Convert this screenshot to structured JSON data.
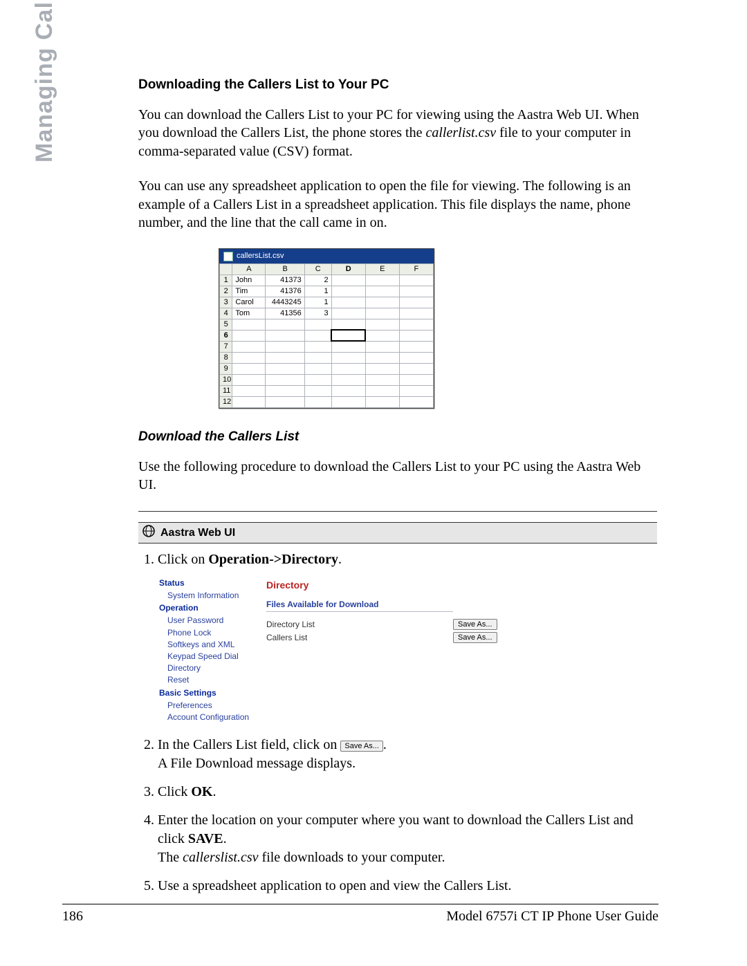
{
  "sidebar_label": "Managing Calls",
  "section": {
    "title": "Downloading the Callers List to Your PC",
    "para1_a": "You can download the Callers List to your PC for viewing using the Aastra Web UI. When you download the Callers List, the phone stores the ",
    "para1_file": "callerlist.csv",
    "para1_b": " file to your computer in comma-separated value (CSV) format.",
    "para2": "You can use any spreadsheet application to open the file for viewing. The following is an example of a Callers List in a spreadsheet application. This file displays the name, phone number, and the line that the call came in on."
  },
  "spreadsheet": {
    "filename": "callersList.csv",
    "cols": [
      "A",
      "B",
      "C",
      "D",
      "E",
      "F"
    ],
    "rows": [
      {
        "rh": "1",
        "A": "John",
        "B": "41373",
        "C": "2"
      },
      {
        "rh": "2",
        "A": "Tim",
        "B": "41376",
        "C": "1"
      },
      {
        "rh": "3",
        "A": "Carol",
        "B": "4443245",
        "C": "1"
      },
      {
        "rh": "4",
        "A": "Tom",
        "B": "41356",
        "C": "3"
      },
      {
        "rh": "5"
      },
      {
        "rh": "6"
      },
      {
        "rh": "7"
      },
      {
        "rh": "8"
      },
      {
        "rh": "9"
      },
      {
        "rh": "10"
      },
      {
        "rh": "11"
      },
      {
        "rh": "12"
      }
    ],
    "selected_row": 6,
    "selected_col": "D"
  },
  "procedure": {
    "subtitle": "Download the Callers List",
    "intro": "Use the following procedure to download the Callers List to your PC using the Aastra Web UI.",
    "bar_label": "Aastra Web UI",
    "step1_a": "Click on ",
    "step1_b": "Operation->Directory",
    "step1_c": ".",
    "step2_a": "In the Callers List field, click on ",
    "step2_btn": "Save As...",
    "step2_b": ".",
    "step2_c": "A File Download message displays.",
    "step3_a": "Click ",
    "step3_b": "OK",
    "step3_c": ".",
    "step4_a": "Enter the location on your computer where you want to download the Callers List and click ",
    "step4_b": "SAVE",
    "step4_c": ".",
    "step4_d_a": "The ",
    "step4_d_file": "callerslist.csv",
    "step4_d_b": " file downloads to your computer.",
    "step5": "Use a spreadsheet application to open and view the Callers List."
  },
  "webui": {
    "nav_groups": [
      {
        "label": "Status",
        "items": [
          "System Information"
        ]
      },
      {
        "label": "Operation",
        "items": [
          "User Password",
          "Phone Lock",
          "Softkeys and XML",
          "Keypad Speed Dial",
          "Directory",
          "Reset"
        ]
      },
      {
        "label": "Basic Settings",
        "items": [
          "Preferences",
          "Account Configuration"
        ]
      }
    ],
    "panel_title": "Directory",
    "section_head": "Files Available for Download",
    "rows": [
      {
        "label": "Directory List",
        "button": "Save As..."
      },
      {
        "label": "Callers List",
        "button": "Save As..."
      }
    ]
  },
  "footer": {
    "page": "186",
    "guide": "Model 6757i CT IP Phone User Guide"
  }
}
